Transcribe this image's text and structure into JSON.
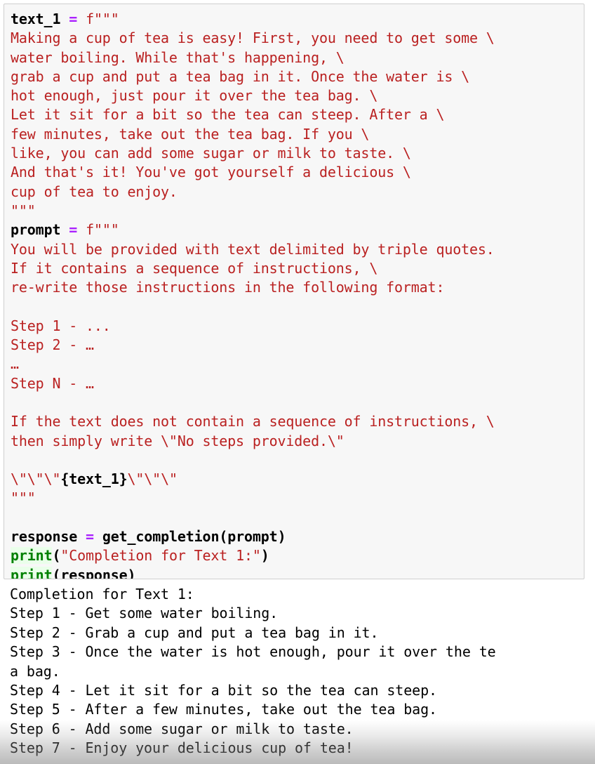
{
  "cell": {
    "type": "code",
    "background_color": "#f7f7f7",
    "border_color": "#cfcfcf",
    "lines": [
      {
        "id": "l01",
        "segments": [
          {
            "cls": "tok-bold",
            "text": "text_1"
          },
          {
            "cls": "tok-plain",
            "text": " "
          },
          {
            "cls": "tok-op",
            "text": "="
          },
          {
            "cls": "tok-plain",
            "text": " "
          },
          {
            "cls": "tok-str",
            "text": "f\"\"\""
          }
        ]
      },
      {
        "id": "l02",
        "segments": [
          {
            "cls": "tok-str",
            "text": "Making a cup of tea is easy! First, you need to get some \\"
          }
        ]
      },
      {
        "id": "l03",
        "segments": [
          {
            "cls": "tok-str",
            "text": "water boiling. While that's happening, \\"
          }
        ]
      },
      {
        "id": "l04",
        "segments": [
          {
            "cls": "tok-str",
            "text": "grab a cup and put a tea bag in it. Once the water is \\"
          }
        ]
      },
      {
        "id": "l05",
        "segments": [
          {
            "cls": "tok-str",
            "text": "hot enough, just pour it over the tea bag. \\"
          }
        ]
      },
      {
        "id": "l06",
        "segments": [
          {
            "cls": "tok-str",
            "text": "Let it sit for a bit so the tea can steep. After a \\"
          }
        ]
      },
      {
        "id": "l07",
        "segments": [
          {
            "cls": "tok-str",
            "text": "few minutes, take out the tea bag. If you \\"
          }
        ]
      },
      {
        "id": "l08",
        "segments": [
          {
            "cls": "tok-str",
            "text": "like, you can add some sugar or milk to taste. \\"
          }
        ]
      },
      {
        "id": "l09",
        "segments": [
          {
            "cls": "tok-str",
            "text": "And that's it! You've got yourself a delicious \\"
          }
        ]
      },
      {
        "id": "l10",
        "segments": [
          {
            "cls": "tok-str",
            "text": "cup of tea to enjoy."
          }
        ]
      },
      {
        "id": "l11",
        "segments": [
          {
            "cls": "tok-str",
            "text": "\"\"\""
          }
        ]
      },
      {
        "id": "l12",
        "segments": [
          {
            "cls": "tok-bold",
            "text": "prompt"
          },
          {
            "cls": "tok-plain",
            "text": " "
          },
          {
            "cls": "tok-op",
            "text": "="
          },
          {
            "cls": "tok-plain",
            "text": " "
          },
          {
            "cls": "tok-str",
            "text": "f\"\"\""
          }
        ]
      },
      {
        "id": "l13",
        "segments": [
          {
            "cls": "tok-str",
            "text": "You will be provided with text delimited by triple quotes."
          }
        ]
      },
      {
        "id": "l14",
        "segments": [
          {
            "cls": "tok-str",
            "text": "If it contains a sequence of instructions, \\"
          }
        ]
      },
      {
        "id": "l15",
        "segments": [
          {
            "cls": "tok-str",
            "text": "re-write those instructions in the following format:"
          }
        ]
      },
      {
        "id": "l16",
        "segments": [
          {
            "cls": "tok-str",
            "text": ""
          }
        ]
      },
      {
        "id": "l17",
        "segments": [
          {
            "cls": "tok-str",
            "text": "Step 1 - ..."
          }
        ]
      },
      {
        "id": "l18",
        "segments": [
          {
            "cls": "tok-str",
            "text": "Step 2 - …"
          }
        ]
      },
      {
        "id": "l19",
        "segments": [
          {
            "cls": "tok-str",
            "text": "…"
          }
        ]
      },
      {
        "id": "l20",
        "segments": [
          {
            "cls": "tok-str",
            "text": "Step N - …"
          }
        ]
      },
      {
        "id": "l21",
        "segments": [
          {
            "cls": "tok-str",
            "text": ""
          }
        ]
      },
      {
        "id": "l22",
        "segments": [
          {
            "cls": "tok-str",
            "text": "If the text does not contain a sequence of instructions, \\"
          }
        ]
      },
      {
        "id": "l23",
        "segments": [
          {
            "cls": "tok-str",
            "text": "then simply write \\\"No steps provided.\\\""
          }
        ]
      },
      {
        "id": "l24",
        "segments": [
          {
            "cls": "tok-str",
            "text": ""
          }
        ]
      },
      {
        "id": "l25",
        "segments": [
          {
            "cls": "tok-str",
            "text": "\\\"\\\"\\\""
          },
          {
            "cls": "tok-interp",
            "text": "{text_1}"
          },
          {
            "cls": "tok-str",
            "text": "\\\"\\\"\\\""
          }
        ]
      },
      {
        "id": "l26",
        "segments": [
          {
            "cls": "tok-str",
            "text": "\"\"\""
          }
        ]
      },
      {
        "id": "l27",
        "segments": [
          {
            "cls": "tok-plain",
            "text": ""
          }
        ]
      },
      {
        "id": "l28",
        "segments": [
          {
            "cls": "tok-bold",
            "text": "response"
          },
          {
            "cls": "tok-plain",
            "text": " "
          },
          {
            "cls": "tok-op",
            "text": "="
          },
          {
            "cls": "tok-plain",
            "text": " "
          },
          {
            "cls": "tok-bold",
            "text": "get_completion(prompt)"
          }
        ]
      },
      {
        "id": "l29",
        "segments": [
          {
            "cls": "tok-builtin",
            "text": "print"
          },
          {
            "cls": "tok-bold",
            "text": "("
          },
          {
            "cls": "tok-str",
            "text": "\"Completion for Text 1:\""
          },
          {
            "cls": "tok-bold",
            "text": ")"
          }
        ]
      },
      {
        "id": "l30",
        "segments": [
          {
            "cls": "tok-builtin",
            "text": "print"
          },
          {
            "cls": "tok-bold",
            "text": "(response)"
          }
        ]
      }
    ]
  },
  "output": {
    "lines": [
      "Completion for Text 1:",
      "Step 1 - Get some water boiling.",
      "Step 2 - Grab a cup and put a tea bag in it.",
      "Step 3 - Once the water is hot enough, pour it over the te",
      "a bag.",
      "Step 4 - Let it sit for a bit so the tea can steep.",
      "Step 5 - After a few minutes, take out the tea bag.",
      "Step 6 - Add some sugar or milk to taste.",
      "Step 7 - Enjoy your delicious cup of tea!"
    ]
  },
  "theme": {
    "string_color": "#ba2121",
    "operator_color": "#aa22ff",
    "builtin_color": "#008000",
    "builtin_background": "#eaffea",
    "name_color": "#000000",
    "cell_background": "#f7f7f7",
    "cell_border": "#cfcfcf",
    "page_background": "#ffffff",
    "output_text_color": "#000000"
  }
}
